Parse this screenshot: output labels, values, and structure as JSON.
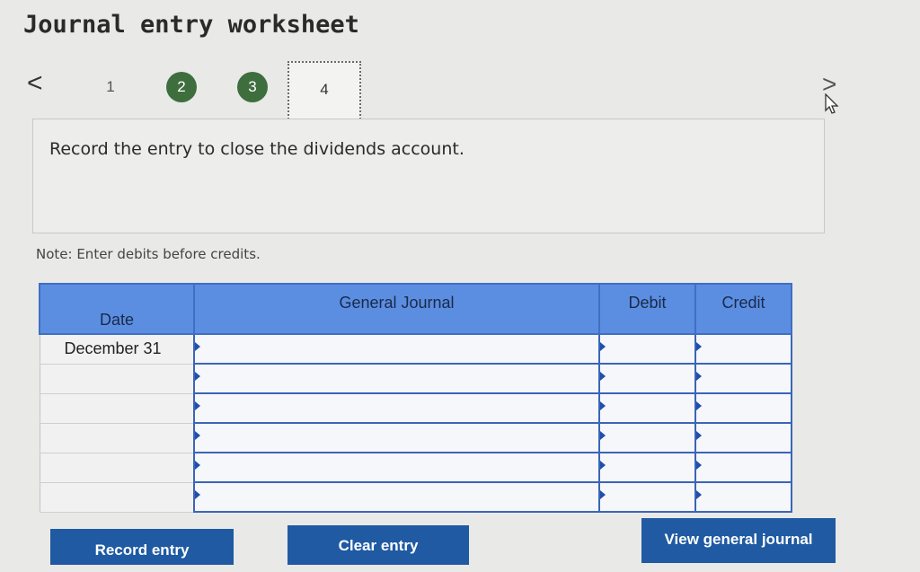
{
  "page": {
    "title": "Journal entry worksheet"
  },
  "nav": {
    "prev": "<",
    "steps": [
      {
        "label": "1",
        "state": "plain"
      },
      {
        "label": "2",
        "state": "done"
      },
      {
        "label": "3",
        "state": "done"
      },
      {
        "label": "4",
        "state": "current"
      }
    ],
    "next": ">"
  },
  "prompt": {
    "text": "Record the entry to close the dividends account."
  },
  "note": "Note: Enter debits before credits.",
  "journal": {
    "headers": {
      "date": "Date",
      "general_journal": "General Journal",
      "debit": "Debit",
      "credit": "Credit"
    },
    "rows": [
      {
        "date": "December 31",
        "account": "",
        "debit": "",
        "credit": ""
      },
      {
        "date": "",
        "account": "",
        "debit": "",
        "credit": ""
      },
      {
        "date": "",
        "account": "",
        "debit": "",
        "credit": ""
      },
      {
        "date": "",
        "account": "",
        "debit": "",
        "credit": ""
      },
      {
        "date": "",
        "account": "",
        "debit": "",
        "credit": ""
      },
      {
        "date": "",
        "account": "",
        "debit": "",
        "credit": ""
      }
    ]
  },
  "buttons": {
    "record": "Record entry",
    "clear": "Clear entry",
    "view": "View general journal"
  },
  "colors": {
    "header_blue": "#5b8ee1",
    "button_blue": "#1f5aa3",
    "step_done_green": "#3e6e3e"
  }
}
